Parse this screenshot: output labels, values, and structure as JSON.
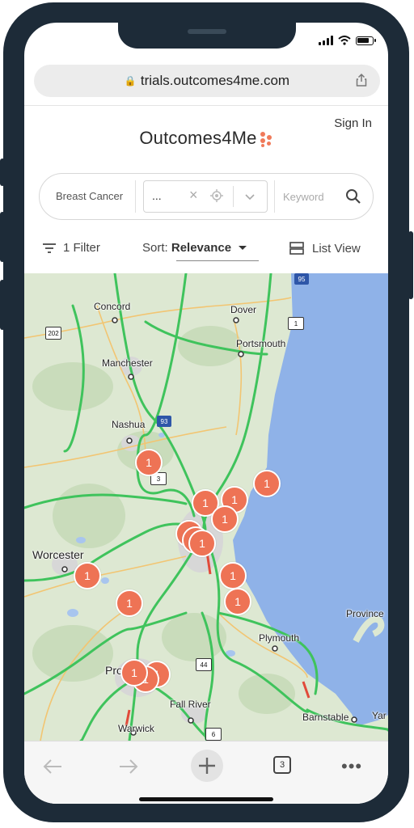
{
  "browser": {
    "url": "trials.outcomes4me.com",
    "tab_count": "3"
  },
  "header": {
    "sign_in": "Sign In",
    "logo_text": "Outcomes4Me"
  },
  "search": {
    "cancer_type": "Breast Cancer",
    "location_value": "...",
    "keyword_placeholder": "Keyword"
  },
  "toolbar": {
    "filter_label": "1 Filter",
    "sort_label": "Sort:",
    "sort_value": "Relevance",
    "view_label": "List View"
  },
  "map": {
    "cities": {
      "concord": "Concord",
      "dover": "Dover",
      "portsmouth": "Portsmouth",
      "manchester": "Manchester",
      "nashua": "Nashua",
      "worcester": "Worcester",
      "plymouth": "Plymouth",
      "providence": "Providence",
      "fall_river": "Fall River",
      "barnstable": "Barnstable",
      "provincetown": "Province",
      "warwick": "Warwick",
      "yarmouth": "Yar"
    },
    "shields": {
      "i95": "95",
      "us1": "1",
      "nh202": "202",
      "i93": "93",
      "us3": "3",
      "ri44": "44",
      "ri6": "6"
    },
    "cluster_count": "1"
  },
  "colors": {
    "frame": "#1d2b38",
    "marker": "#ee7355",
    "water": "#8fb2e8",
    "land": "#dde8d2",
    "highway": "#3fc35c"
  }
}
